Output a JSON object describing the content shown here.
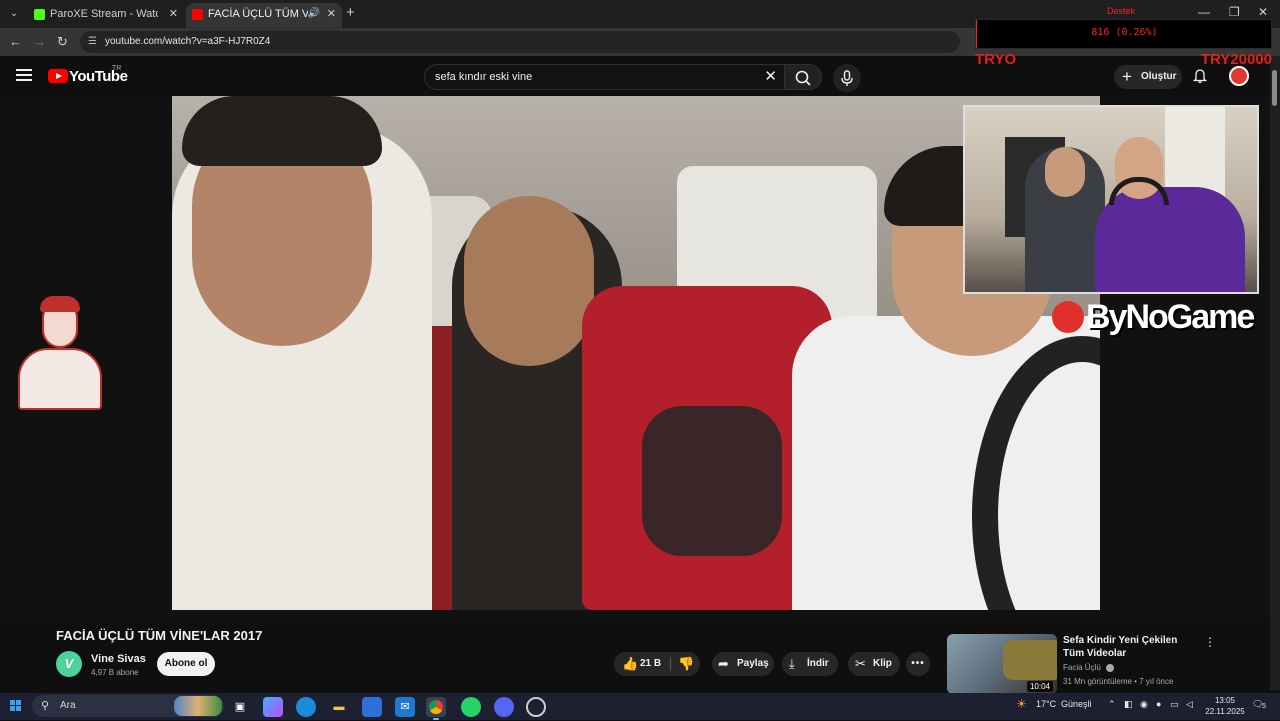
{
  "browser": {
    "tabs": [
      {
        "title": "ParoXE Stream - Watch Live on",
        "favicon_color": "#53fc18"
      },
      {
        "title": "FACİA ÜÇLÜ TÜM VİNE'LAR",
        "favicon_color": "#ff0000",
        "active": true
      }
    ],
    "url": "youtube.com/watch?v=a3F-HJ7R0Z4"
  },
  "youtube": {
    "logo_text": "YouTube",
    "region": "TR",
    "search_value": "sefa kındır eski vine",
    "create_label": "Oluştur"
  },
  "overlay": {
    "donation_label": "Destek",
    "donation_value": "816 (0.26%)",
    "donation_progress_pct": 0.26,
    "left_tag": "TRYO",
    "right_tag": "TRY20000",
    "sponsor": "ByNoGame"
  },
  "video": {
    "title": "FACİA ÜÇLÜ TÜM VİNE'LAR 2017",
    "channel": {
      "name": "Vine Sivas",
      "subs": "4,97 B abone",
      "avatar_letter": "V"
    },
    "subscribe_label": "Abone ol",
    "likes": "21 B",
    "share_label": "Paylaş",
    "download_label": "İndir",
    "clip_label": "Klip",
    "more_label": "•••"
  },
  "recommended": {
    "title": "Sefa Kindir Yeni Çekilen Tüm Videolar",
    "channel": "Facia Üçlü",
    "meta": "31 Mn görüntüleme • 7 yıl önce",
    "duration": "10:04"
  },
  "taskbar": {
    "search_placeholder": "Ara",
    "weather": "17°C",
    "weather_desc": "Güneşli",
    "time": "13:05",
    "date": "22.11.2025",
    "notif_count": "5"
  }
}
